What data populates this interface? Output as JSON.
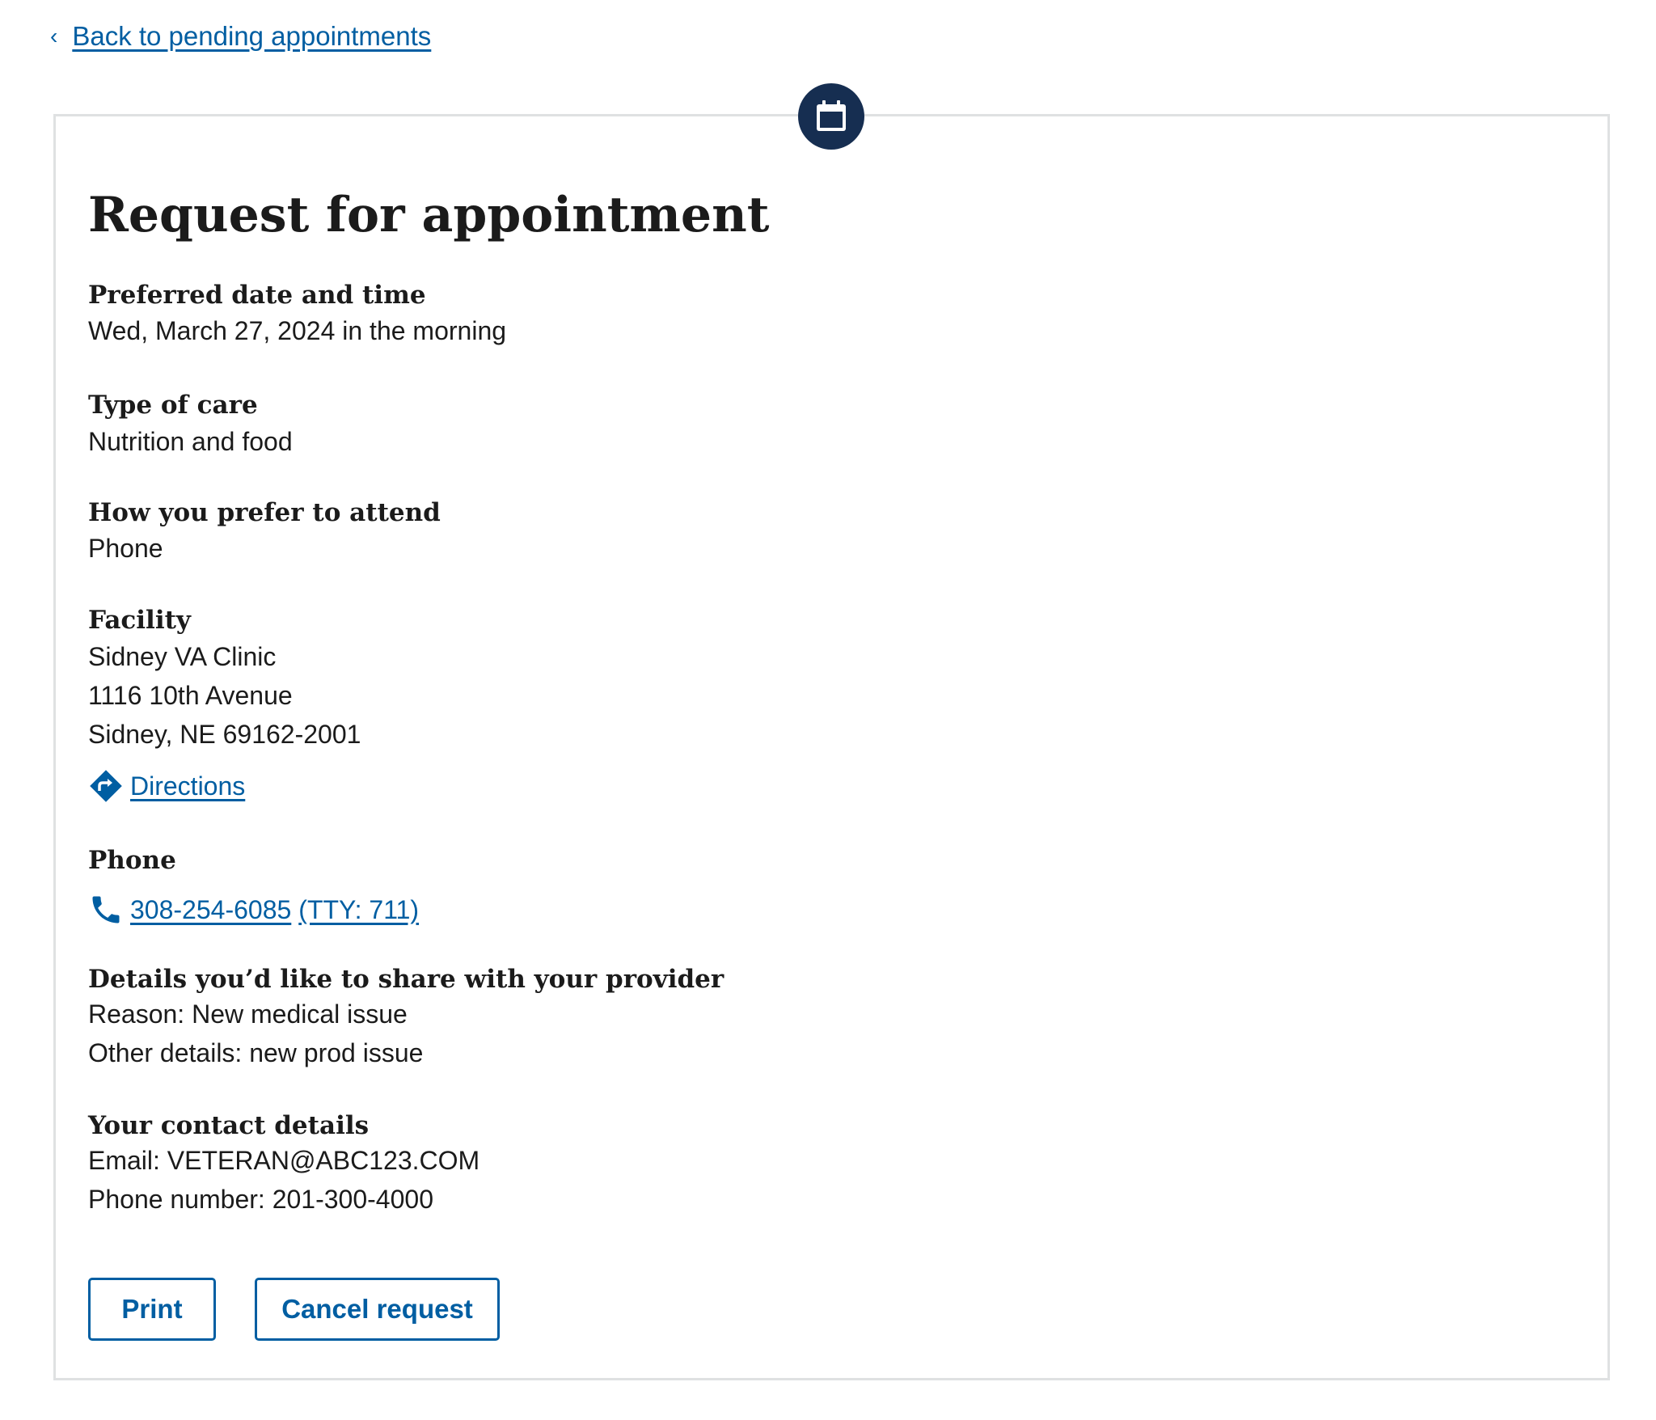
{
  "back_link": {
    "label": "Back to pending appointments"
  },
  "badge": {
    "icon": "calendar-icon"
  },
  "title": "Request for appointment",
  "preferred": {
    "label": "Preferred date and time",
    "value": "Wed, March 27, 2024 in the morning"
  },
  "type_of_care": {
    "label": "Type of care",
    "value": "Nutrition and food"
  },
  "attend": {
    "label": "How you prefer to attend",
    "value": "Phone"
  },
  "facility": {
    "label": "Facility",
    "name": "Sidney VA Clinic",
    "street": "1116 10th Avenue",
    "city": "Sidney, NE 69162-2001",
    "directions_label": "Directions",
    "directions_icon": "directions-icon"
  },
  "phone": {
    "label": "Phone",
    "number": "308-254-6085",
    "tty": "(TTY: 711)",
    "icon": "phone-icon"
  },
  "details": {
    "label": "Details you’d like to share with your provider",
    "reason": "Reason: New medical issue",
    "other": "Other details: new prod issue"
  },
  "contact": {
    "label": "Your contact details",
    "email": "Email: VETERAN@ABC123.COM",
    "phone": "Phone number: 201-300-4000"
  },
  "buttons": {
    "print": "Print",
    "cancel": "Cancel request"
  },
  "colors": {
    "link": "#005ea2",
    "badge": "#162e51",
    "border": "#dfe1e2",
    "text": "#1b1b1b"
  }
}
